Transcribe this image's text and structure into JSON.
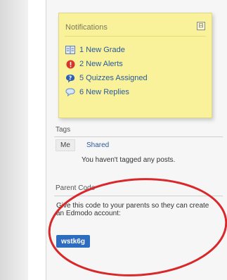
{
  "notifications": {
    "title": "Notifications",
    "collapse_symbol": "⊟",
    "items": [
      {
        "icon": "grade-book-icon",
        "label": "1 New Grade"
      },
      {
        "icon": "alert-icon",
        "label": "2 New Alerts"
      },
      {
        "icon": "quiz-question-icon",
        "label": "5 Quizzes Assigned"
      },
      {
        "icon": "reply-bubble-icon",
        "label": "6 New Replies"
      }
    ]
  },
  "tags": {
    "heading": "Tags",
    "tab_me": "Me",
    "tab_shared": "Shared",
    "empty_message": "You haven't tagged any posts."
  },
  "parent_code": {
    "heading": "Parent Code",
    "description": "Give this code to your parents so they can create an Edmodo account:",
    "code": "wstk6g"
  },
  "colors": {
    "sticky_note": "#f9f29a",
    "link_blue": "#2a5a9a",
    "code_button": "#2e6cc0",
    "annotation_circle": "#d9282b"
  }
}
